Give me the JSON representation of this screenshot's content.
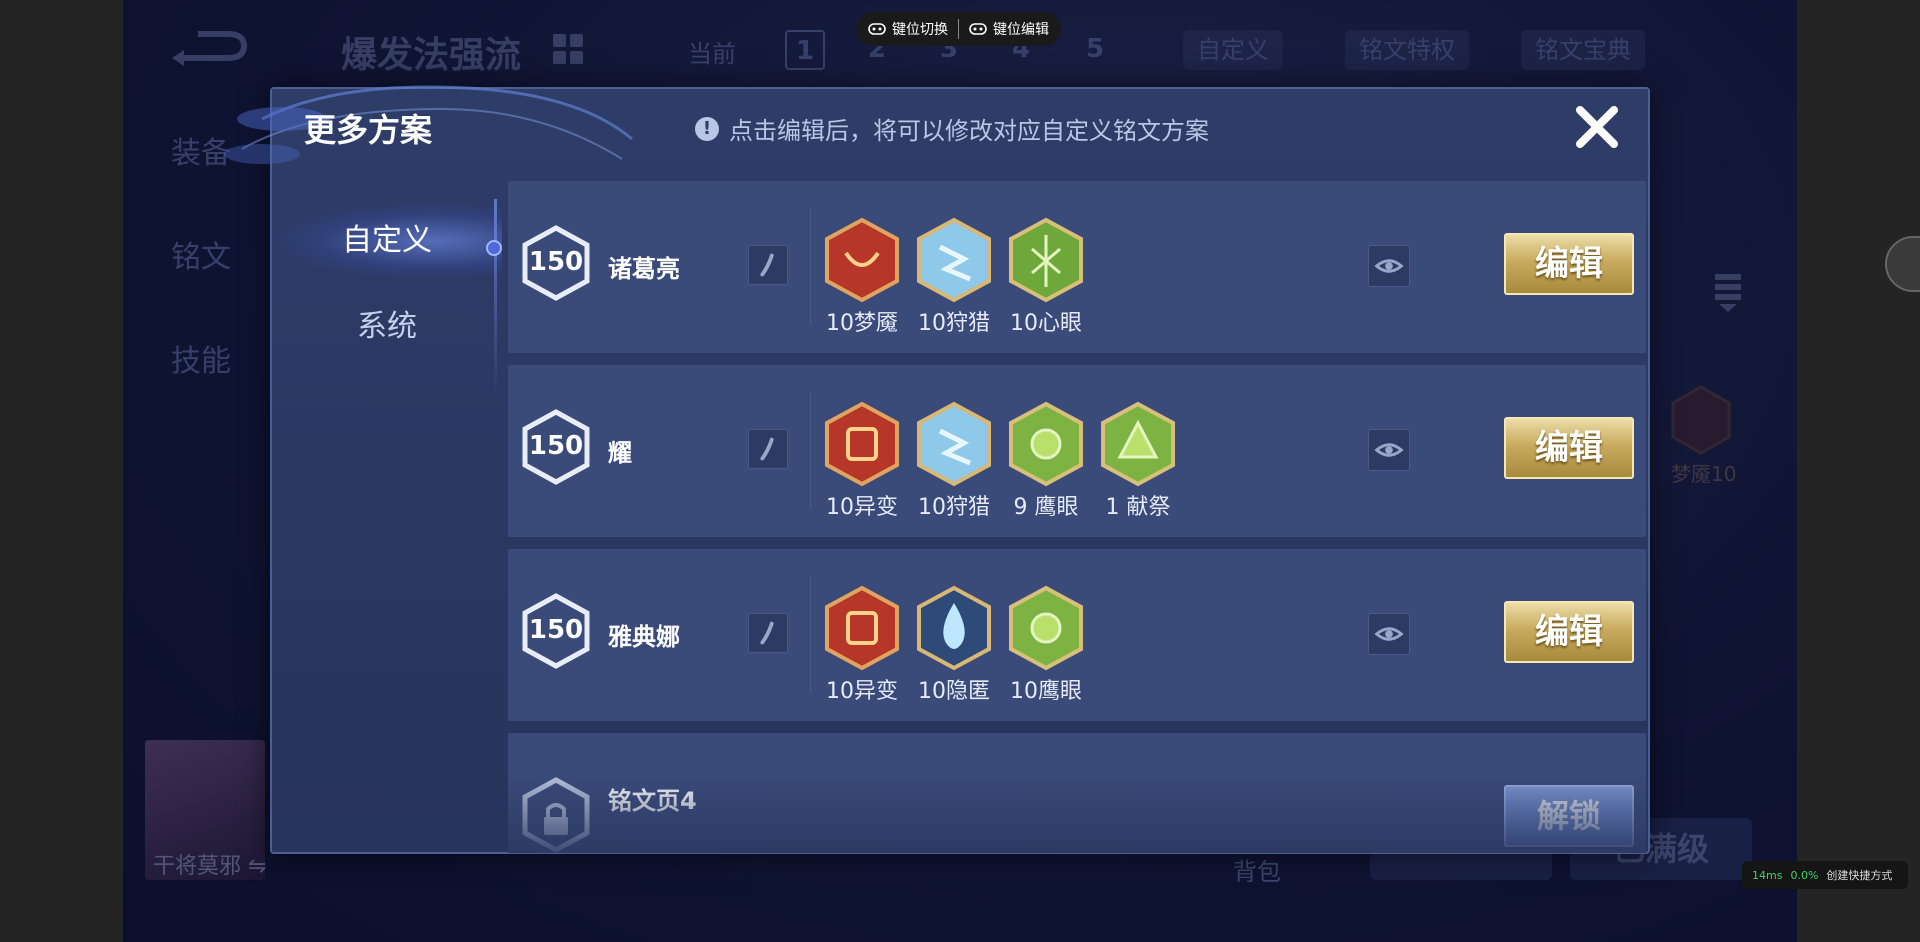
{
  "toolbar": {
    "key_switch": "键位切换",
    "key_edit": "键位编辑"
  },
  "background": {
    "title": "爆发法强流",
    "current_label": "当前",
    "pages": [
      "1",
      "2",
      "3",
      "4",
      "5"
    ],
    "tabs": [
      "自定义",
      "铭文特权",
      "铭文宝典"
    ],
    "left_nav": [
      "装备",
      "铭文",
      "技能"
    ],
    "hero_name": "干将莫邪 ⇋",
    "rune_label": "梦魇10",
    "bag": "背包",
    "btn_upgrade": "已满级"
  },
  "modal": {
    "title": "更多方案",
    "hint": "点击编辑后，将可以修改对应自定义铭文方案",
    "tabs": [
      {
        "label": "自定义"
      },
      {
        "label": "系统"
      }
    ],
    "rows": [
      {
        "level": "150",
        "name": "诸葛亮",
        "edit": "编辑",
        "runes": [
          {
            "label": "10梦魇",
            "color": "red"
          },
          {
            "label": "10狩猎",
            "color": "blue"
          },
          {
            "label": "10心眼",
            "color": "green"
          }
        ]
      },
      {
        "level": "150",
        "name": "耀",
        "edit": "编辑",
        "runes": [
          {
            "label": "10异变",
            "color": "red"
          },
          {
            "label": "10狩猎",
            "color": "blue"
          },
          {
            "label": "9 鹰眼",
            "color": "green"
          },
          {
            "label": "1 献祭",
            "color": "green"
          }
        ]
      },
      {
        "level": "150",
        "name": "雅典娜",
        "edit": "编辑",
        "runes": [
          {
            "label": "10异变",
            "color": "red"
          },
          {
            "label": "10隐匿",
            "color": "blue"
          },
          {
            "label": "10鹰眼",
            "color": "green"
          }
        ]
      },
      {
        "name": "铭文页4",
        "unlock": "解锁"
      }
    ]
  },
  "status": {
    "latency": "14ms",
    "loss": "0.0%",
    "shortcut": "创建快捷方式"
  },
  "colors": {
    "gold": "#c8ab5e",
    "panel": "#2e3c68",
    "row": "#3a4a79",
    "red_rune": "#c0392b",
    "blue_rune": "#8ec9ea",
    "green_rune": "#7cb342"
  }
}
